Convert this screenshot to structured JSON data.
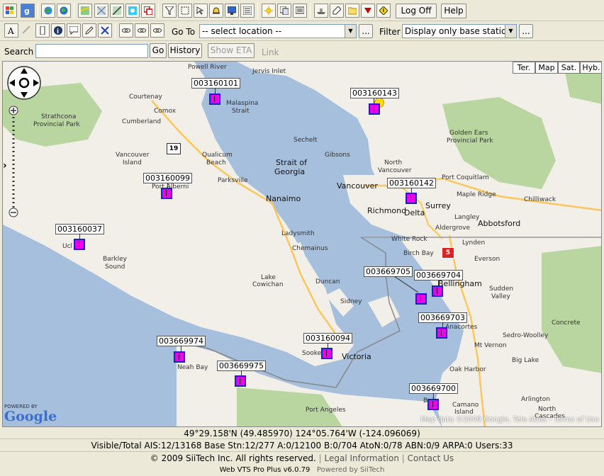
{
  "toolbar1": {
    "logoff_label": "Log Off",
    "help_label": "Help"
  },
  "toolbar2": {
    "goto_label": "Go To",
    "goto_value": "-- select location --",
    "more_label": "...",
    "filter_label": "Filter",
    "filter_value": "Display only base station",
    "filter_more_label": "..."
  },
  "toolbar3": {
    "search_label": "Search",
    "search_value": "",
    "go_label": "Go",
    "history_label": "History",
    "show_eta_label": "Show ETA",
    "link_label": "Link"
  },
  "map": {
    "map_types": [
      "Ter.",
      "Map",
      "Sat.",
      "Hyb."
    ],
    "attribution": "Map data ©2009 Google, Tele Atlas - Terms of Use",
    "powered_by": "POWERED BY",
    "google": "Google",
    "place_labels": {
      "powell_river": "Powell River",
      "jervis_inlet": "Jervis Inlet",
      "courtenay": "Courtenay",
      "comox": "Comox",
      "malaspina": "Malaspina",
      "strait": "Strait",
      "cumberland": "Cumberland",
      "strathcona": "Strathcona",
      "provincial_park": "Provincial Park",
      "sechelt": "Sechelt",
      "vancouver_island1": "Vancouver",
      "vancouver_island2": "Island",
      "qualicum1": "Qualicum",
      "qualicum2": "Beach",
      "gibsons": "Gibsons",
      "strait_of": "Strait of",
      "georgia": "Georgia",
      "parksville": "Parksville",
      "port_alberni": "Port Alberni",
      "north_vancouver1": "North",
      "north_vancouver2": "Vancouver",
      "port_coquitlam": "Port Coquitlam",
      "golden_ears1": "Golden Ears",
      "golden_ears2": "Provincial Park",
      "vancouver": "Vancouver",
      "nanaimo": "Nanaimo",
      "surrey": "Surrey",
      "maple_ridge": "Maple Ridge",
      "richmond": "Richmond",
      "delta": "Delta",
      "chilliwack": "Chilliwack",
      "langley": "Langley",
      "abbotsford": "Abbotsford",
      "aldergrove": "Aldergrove",
      "ladysmith": "Ladysmith",
      "ucluelet": "Ucl",
      "white_rock": "White Rock",
      "lynden": "Lynden",
      "chemainus": "Chemainus",
      "barkley1": "Barkley",
      "barkley2": "Sound",
      "birch_bay": "Birch Bay",
      "everson": "Everson",
      "lake_cowichan1": "Lake",
      "lake_cowichan2": "Cowichan",
      "duncan": "Duncan",
      "bellingham": "Bellingham",
      "sudden_valley1": "Sudden",
      "sudden_valley2": "Valley",
      "sidney": "Sidney",
      "anacortes": "Anacortes",
      "sedro_woolley": "Sedro-Woolley",
      "concrete": "Concrete",
      "mt_vernon": "Mt Vernon",
      "big_lake": "Big Lake",
      "sooke": "Sooke",
      "victoria": "Victoria",
      "neah_bay": "Neah Bay",
      "oak_harbor": "Oak Harbor",
      "arlington": "Arlington",
      "port_angeles": "Port Angeles",
      "camano1": "Camano",
      "camano2": "Island",
      "north_cascades1": "North",
      "north_cascades2": "Cascades",
      "highway_19": "19",
      "highway_5": "5",
      "bai": "Bai"
    },
    "vessels": [
      {
        "id": "003160101"
      },
      {
        "id": "003160143"
      },
      {
        "id": "003160099"
      },
      {
        "id": "003160142"
      },
      {
        "id": "003160037"
      },
      {
        "id": "003669705"
      },
      {
        "id": "003669704"
      },
      {
        "id": "003669703"
      },
      {
        "id": "003160094"
      },
      {
        "id": "003669974"
      },
      {
        "id": "003669975"
      },
      {
        "id": "003669700"
      }
    ]
  },
  "status": {
    "coordinates": "49°29.158'N (49.485970)   124°05.764'W (-124.096069)",
    "counts": "Visible/Total AIS:12/13168  Base Stn:12/277  A:0/12100  B:0/704  AtoN:0/78  ABN:0/9  ARPA:0  Users:33",
    "copyright": "© 2009 SiiTech Inc. All rights reserved.",
    "legal_link": "Legal Information",
    "contact_link": "Contact Us",
    "version": "Web VTS Pro Plus v6.0.79",
    "powered": "Powered by SiiTech"
  }
}
